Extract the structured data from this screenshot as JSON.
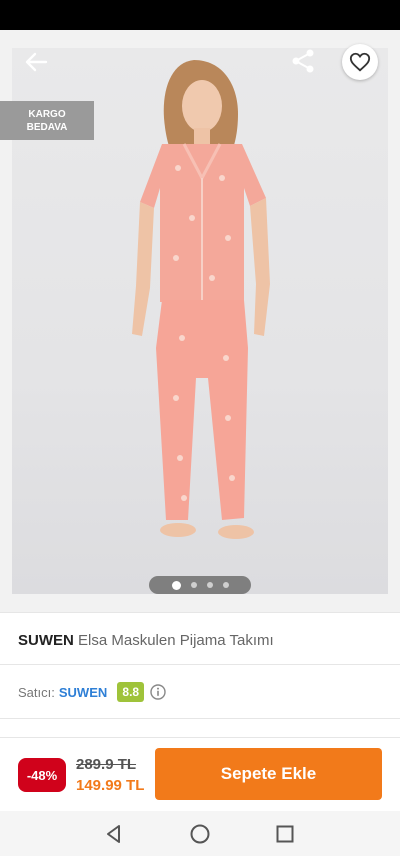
{
  "gallery": {
    "cargo_badge": {
      "line1": "KARGO",
      "line2": "BEDAVA"
    },
    "page_count": 4,
    "active_page": 1
  },
  "product": {
    "brand": "SUWEN",
    "name": "Elsa Maskulen Pijama Takımı"
  },
  "seller": {
    "label": "Satıcı:",
    "name": "SUWEN",
    "score": "8.8"
  },
  "purchase": {
    "discount": "-48%",
    "old_price": "289.9 TL",
    "new_price": "149.99 TL",
    "add_to_cart_label": "Sepete Ekle"
  },
  "colors": {
    "accent": "#f27a1a",
    "discount": "#d0021b",
    "seller_link": "#2e7fd6",
    "score": "#9fc33a"
  },
  "icons": [
    "back-arrow-icon",
    "share-icon",
    "heart-icon",
    "info-icon",
    "nav-back-icon",
    "nav-home-icon",
    "nav-recents-icon"
  ]
}
